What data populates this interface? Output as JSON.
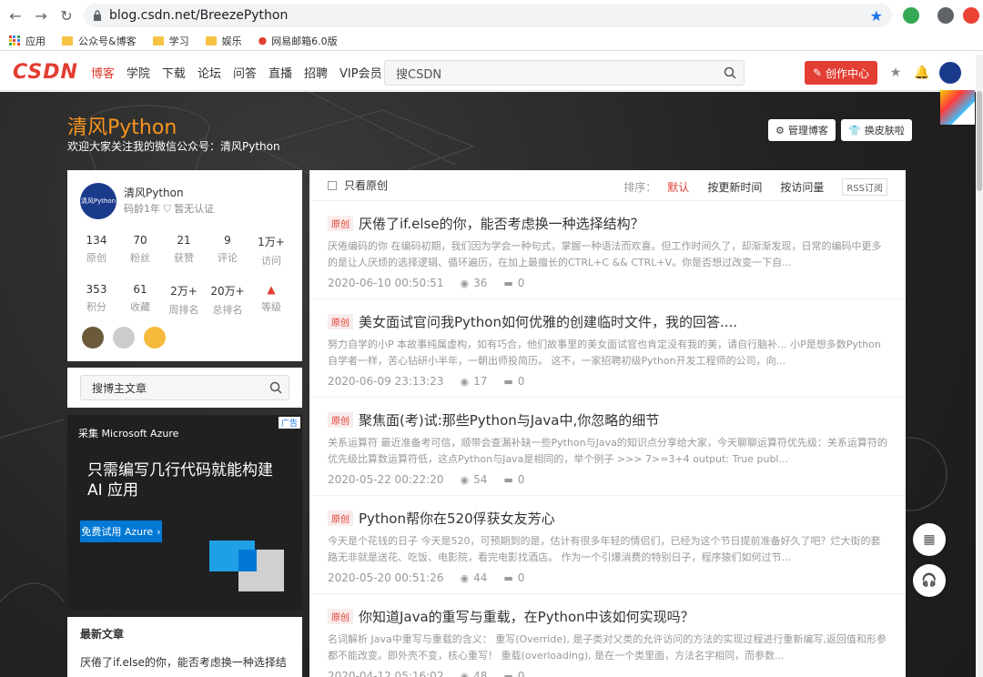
{
  "browser": {
    "url": "blog.csdn.net/BreezePython",
    "bookmarks": [
      "应用",
      "公众号&博客",
      "学习",
      "娱乐",
      "网易邮箱6.0版"
    ]
  },
  "toolbar": {
    "logo": "CSDN",
    "nav": [
      "博客",
      "学院",
      "下载",
      "论坛",
      "问答",
      "直播",
      "招聘",
      "VIP会员"
    ],
    "search_placeholder": "搜CSDN",
    "create": "创作中心"
  },
  "blog": {
    "title": "清风Python",
    "subtitle": "欢迎大家关注我的微信公众号：清风Python",
    "manage": "管理博客",
    "skin": "换皮肤啦"
  },
  "profile": {
    "name": "清风Python",
    "age": "码龄1年",
    "cert": "暂无认证",
    "avatar_text": "清风Python",
    "stats_row1": [
      {
        "value": "134",
        "label": "原创"
      },
      {
        "value": "70",
        "label": "粉丝"
      },
      {
        "value": "21",
        "label": "获赞"
      },
      {
        "value": "9",
        "label": "评论"
      },
      {
        "value": "1万+",
        "label": "访问"
      }
    ],
    "stats_row2": [
      {
        "value": "353",
        "label": "积分"
      },
      {
        "value": "61",
        "label": "收藏"
      },
      {
        "value": "2万+",
        "label": "周排名"
      },
      {
        "value": "20万+",
        "label": "总排名"
      },
      {
        "value": "",
        "label": "等级"
      }
    ]
  },
  "sidebar_search": "搜博主文章",
  "ad": {
    "brand": "采集 Microsoft Azure",
    "tag": "广告",
    "headline": "只需编写几行代码就能构建 AI 应用",
    "cta": "免费试用 Azure"
  },
  "latest": {
    "header": "最新文章",
    "first": "厌倦了if.else的你，能否考虑换一种选择结"
  },
  "list": {
    "only_original": "只看原创",
    "sort_label": "排序：",
    "sort_options": [
      "默认",
      "按更新时间",
      "按访问量"
    ],
    "rss": "RSS订阅",
    "tag": "原创",
    "articles": [
      {
        "title": "厌倦了if.else的你，能否考虑换一种选择结构？",
        "desc": "厌倦编码的你 在编码初期，我们因为学会一种句式，掌握一种语法而欢喜。但工作时间久了，却渐渐发现，日常的编码中更多的是让人厌烦的选择逻辑、循环遍历，在加上最擅长的CTRL+C && CTRL+V。你是否想过改变一下自...",
        "date": "2020-06-10 00:50:51",
        "views": "36",
        "comments": "0"
      },
      {
        "title": "美女面试官问我Python如何优雅的创建临时文件，我的回答....",
        "desc": "努力自学的小P 本故事纯属虚构，如有巧合，他们故事里的美女面试官也肯定没有我的美，请自行脑补... 小P是想多数Python自学者一样，苦心钻研小半年，一朝出师投简历。 这不，一家招聘初级Python开发工程师的公司，向...",
        "date": "2020-06-09 23:13:23",
        "views": "17",
        "comments": "0"
      },
      {
        "title": "聚焦面(考)试:那些Python与Java中,你忽略的细节",
        "desc": "关系运算符 最近准备考可信，顺带会查漏补缺一些Python与Java的知识点分享给大家，今天聊聊运算符优先级：关系运算符的优先级比算数运算符低，这点Python与Java是相同的，举个例子 >>> 7>=3+4 output: True publ...",
        "date": "2020-05-22 00:22:20",
        "views": "54",
        "comments": "0"
      },
      {
        "title": "Python帮你在520俘获女友芳心",
        "desc": "今天是个花钱的日子 今天是520，可预期到的是，估计有很多年轻的情侣们，已经为这个节日提前准备好久了吧？烂大街的套路无非就是送花、吃饭、电影院，看完电影找酒店。 作为一个引爆消费的特别日子，程序猿们如何过节...",
        "date": "2020-05-20 00:51:26",
        "views": "44",
        "comments": "0"
      },
      {
        "title": "你知道Java的重写与重载，在Python中该如何实现吗？",
        "desc": "名词解析 Java中重写与重载的含义： 重写(Override), 是子类对父类的允许访问的方法的实现过程进行重新编写,返回值和形参都不能改变。即外壳不变，核心重写！ 重载(overloading), 是在一个类里面，方法名字相同，而参数...",
        "date": "2020-04-12 05:16:02",
        "views": "48",
        "comments": "0"
      }
    ]
  }
}
